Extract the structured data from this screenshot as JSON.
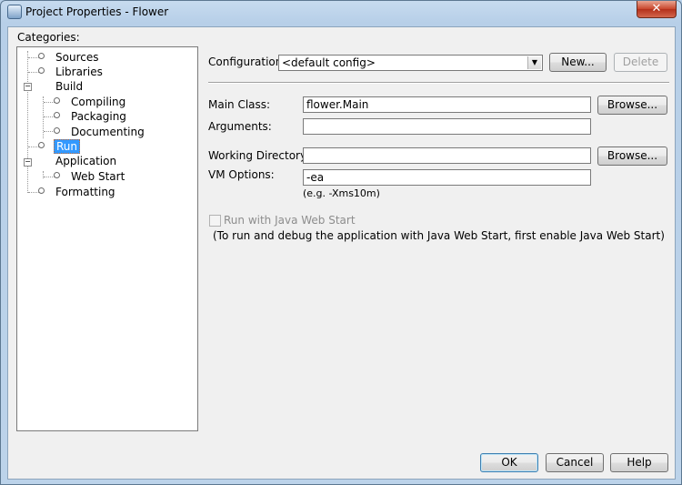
{
  "window": {
    "title": "Project Properties - Flower",
    "close_glyph": "✕"
  },
  "categories": {
    "label": "Categories:",
    "items": [
      {
        "label": "Sources",
        "level": 0
      },
      {
        "label": "Libraries",
        "level": 0
      },
      {
        "label": "Build",
        "level": 0,
        "expanded": true
      },
      {
        "label": "Compiling",
        "level": 1
      },
      {
        "label": "Packaging",
        "level": 1
      },
      {
        "label": "Documenting",
        "level": 1
      },
      {
        "label": "Run",
        "level": 0,
        "selected": true
      },
      {
        "label": "Application",
        "level": 0,
        "expanded": true
      },
      {
        "label": "Web Start",
        "level": 1
      },
      {
        "label": "Formatting",
        "level": 0
      }
    ]
  },
  "configuration": {
    "label": "Configuration:",
    "value": "<default config>",
    "new_label": "New...",
    "delete_label": "Delete"
  },
  "run": {
    "main_class_label": "Main Class:",
    "main_class_value": "flower.Main",
    "browse_label": "Browse...",
    "arguments_label": "Arguments:",
    "arguments_value": "",
    "working_dir_label": "Working Directory:",
    "working_dir_value": "",
    "vm_options_label": "VM Options:",
    "vm_options_value": "-ea",
    "vm_options_hint": "(e.g. -Xms10m)",
    "web_start_checkbox_label": "Run with Java Web Start",
    "web_start_note": "(To run and debug the application with Java Web Start, first enable Java Web Start)"
  },
  "footer": {
    "ok_label": "OK",
    "cancel_label": "Cancel",
    "help_label": "Help"
  }
}
